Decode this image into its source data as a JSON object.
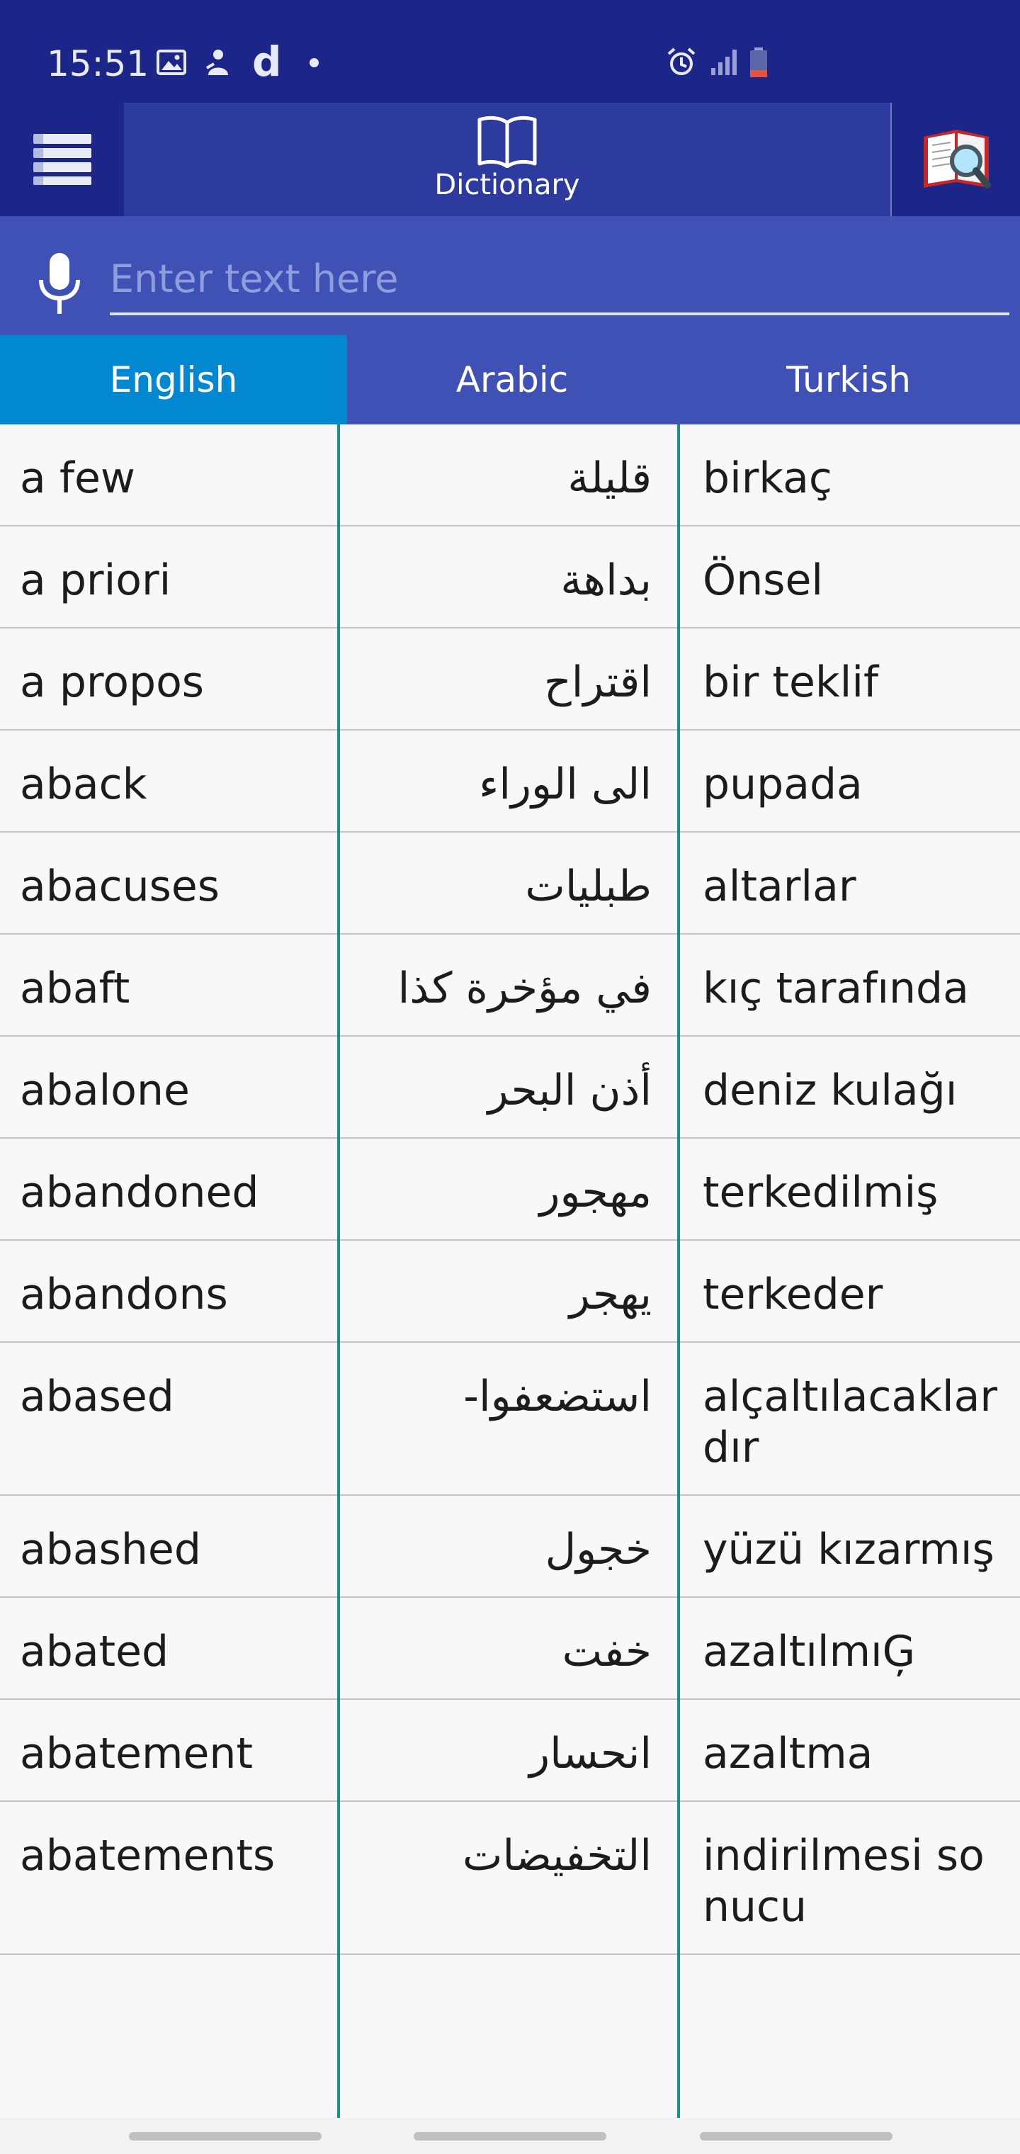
{
  "status_bar": {
    "time": "15:51",
    "icons": [
      "image-icon",
      "person-icon",
      "d-app-icon",
      "dot-icon",
      "alarm-icon",
      "signal-icon",
      "battery-low-icon"
    ],
    "d_glyph": "d"
  },
  "header": {
    "menu_icon": "hamburger-menu-icon",
    "dictionary_tab_icon": "open-book-icon",
    "dictionary_label": "Dictionary",
    "search_book_icon": "book-magnifier-icon"
  },
  "search": {
    "mic_icon": "microphone-icon",
    "placeholder": "Enter text here",
    "value": ""
  },
  "language_tabs": [
    {
      "label": "English",
      "active": true
    },
    {
      "label": "Arabic",
      "active": false
    },
    {
      "label": "Turkish",
      "active": false
    }
  ],
  "rows": [
    [
      "a few",
      "قليلة",
      "birkaç"
    ],
    [
      "a priori",
      "بداهة",
      "Önsel"
    ],
    [
      "a propos",
      "اقتراح",
      "bir teklif"
    ],
    [
      "aback",
      "الى الوراء",
      "pupada"
    ],
    [
      "abacuses",
      "طبليات",
      "altarlar"
    ],
    [
      "abaft",
      "في مؤخرة كذا",
      "kıç tarafında"
    ],
    [
      "abalone",
      "أذن البحر",
      "deniz kulağı"
    ],
    [
      "abandoned",
      "مهجور",
      "terkedilmiş"
    ],
    [
      "abandons",
      "يهجر",
      "terkeder"
    ],
    [
      "abased",
      "استضعفوا-",
      "alçaltılacaklardır"
    ],
    [
      "abashed",
      "خجول",
      "yüzü kızarmış"
    ],
    [
      "abated",
      "خفت",
      "azaltılmıĢ"
    ],
    [
      "abatement",
      "انحسار",
      "azaltma"
    ],
    [
      "abatements",
      "التخفيضات",
      "indirilmesi sonucu"
    ]
  ],
  "colors": {
    "header_bg": "#1b2688",
    "dictionary_tab_bg": "#2d3a9e",
    "search_bar_bg": "#3f51b5",
    "active_tab_bg": "#0288d1",
    "column_divider": "#179189"
  }
}
